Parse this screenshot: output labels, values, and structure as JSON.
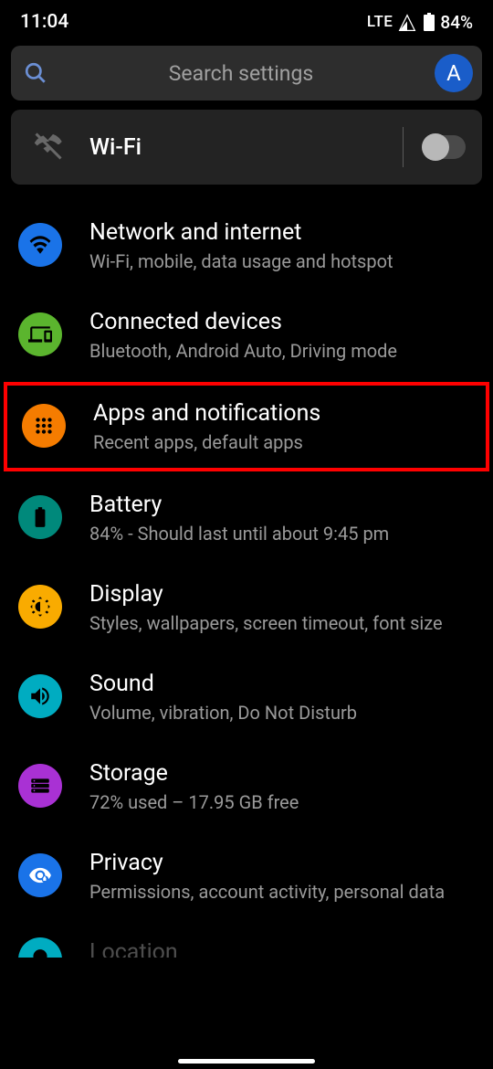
{
  "status": {
    "time": "11:04",
    "network": "LTE",
    "battery": "84%"
  },
  "search": {
    "placeholder": "Search settings",
    "avatar_letter": "A"
  },
  "wifi_card": {
    "label": "Wi-Fi",
    "enabled": false
  },
  "items": [
    {
      "title": "Network and internet",
      "subtitle": "Wi-Fi, mobile, data usage and hotspot",
      "icon": "wifi",
      "icon_bg": "#1a73e8",
      "highlighted": false
    },
    {
      "title": "Connected devices",
      "subtitle": "Bluetooth, Android Auto, Driving mode",
      "icon": "devices",
      "icon_bg": "#5bb52e",
      "highlighted": false
    },
    {
      "title": "Apps and notifications",
      "subtitle": "Recent apps, default apps",
      "icon": "apps",
      "icon_bg": "#f57c00",
      "highlighted": true
    },
    {
      "title": "Battery",
      "subtitle": "84% - Should last until about 9:45 pm",
      "icon": "battery",
      "icon_bg": "#00897b",
      "highlighted": false
    },
    {
      "title": "Display",
      "subtitle": "Styles, wallpapers, screen timeout, font size",
      "icon": "display",
      "icon_bg": "#f9ab00",
      "highlighted": false
    },
    {
      "title": "Sound",
      "subtitle": "Volume, vibration, Do Not Disturb",
      "icon": "sound",
      "icon_bg": "#00acc1",
      "highlighted": false
    },
    {
      "title": "Storage",
      "subtitle": "72% used – 17.95 GB free",
      "icon": "storage",
      "icon_bg": "#a931d4",
      "highlighted": false
    },
    {
      "title": "Privacy",
      "subtitle": "Permissions, account activity, personal data",
      "icon": "privacy",
      "icon_bg": "#1a73e8",
      "highlighted": false
    },
    {
      "title": "Location",
      "subtitle": "",
      "icon": "location",
      "icon_bg": "#00acc1",
      "highlighted": false,
      "partial": true
    }
  ]
}
